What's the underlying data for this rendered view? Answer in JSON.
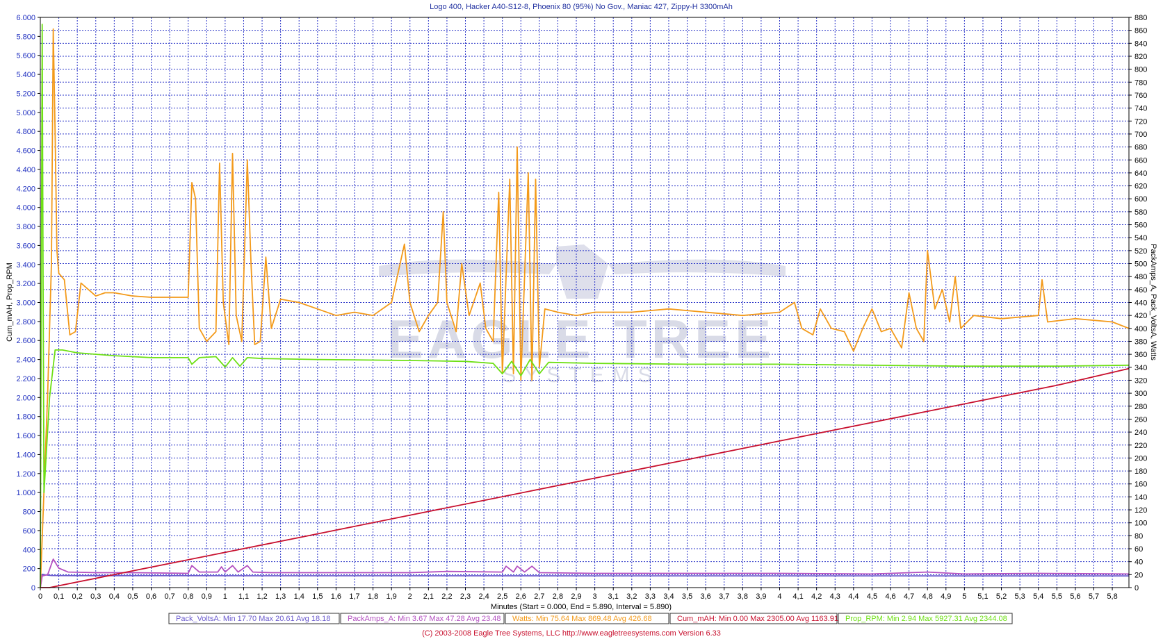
{
  "chart_data": {
    "type": "line",
    "title": "Logo 400, Hacker A40-S12-8, Phoenix 80 (95%) No Gov., Maniac 427, Zippy-H 3300mAh",
    "xlabel": "Minutes (Start = 0.000,  End = 5.890,  Interval =  5.890)",
    "ylabel_left": "Cum_mAH, Prop_RPM",
    "ylabel_right": "PackAmps_A, Pack_VoltsA, Watts",
    "xlim": [
      0,
      5.89
    ],
    "ylim_left": [
      0,
      6000
    ],
    "ylim_right": [
      0,
      880
    ],
    "grid": true,
    "x_ticks": [
      "0",
      "0,1",
      "0,2",
      "0,3",
      "0,4",
      "0,5",
      "0,6",
      "0,7",
      "0,8",
      "0,9",
      "1",
      "1,1",
      "1,2",
      "1,3",
      "1,4",
      "1,5",
      "1,6",
      "1,7",
      "1,8",
      "1,9",
      "2",
      "2,1",
      "2,2",
      "2,3",
      "2,4",
      "2,5",
      "2,6",
      "2,7",
      "2,8",
      "2,9",
      "3",
      "3,1",
      "3,2",
      "3,3",
      "3,4",
      "3,5",
      "3,6",
      "3,7",
      "3,8",
      "3,9",
      "4",
      "4,1",
      "4,2",
      "4,3",
      "4,4",
      "4,5",
      "4,6",
      "4,7",
      "4,8",
      "4,9",
      "5",
      "5,1",
      "5,2",
      "5,3",
      "5,4",
      "5,5",
      "5,6",
      "5,7",
      "5,8"
    ],
    "y_ticks_left": [
      "0",
      "200",
      "400",
      "600",
      "800",
      "1.000",
      "1.200",
      "1.400",
      "1.600",
      "1.800",
      "2.000",
      "2.200",
      "2.400",
      "2.600",
      "2.800",
      "3.000",
      "3.200",
      "3.400",
      "3.600",
      "3.800",
      "4.000",
      "4.200",
      "4.400",
      "4.600",
      "4.800",
      "5.000",
      "5.200",
      "5.400",
      "5.600",
      "5.800",
      "6.000"
    ],
    "y_ticks_right": [
      "0",
      "20",
      "40",
      "60",
      "80",
      "100",
      "120",
      "140",
      "160",
      "180",
      "200",
      "220",
      "240",
      "260",
      "280",
      "300",
      "320",
      "340",
      "360",
      "380",
      "400",
      "420",
      "440",
      "460",
      "480",
      "500",
      "520",
      "540",
      "560",
      "580",
      "600",
      "620",
      "640",
      "660",
      "680",
      "700",
      "720",
      "740",
      "760",
      "780",
      "800",
      "820",
      "840",
      "860",
      "880"
    ],
    "watermark": {
      "line1": "EAGLE TREE",
      "line2": "SYSTEMS"
    },
    "series": [
      {
        "name": "Pack_VoltsA",
        "axis": "right",
        "color": "#6a5acd",
        "points": [
          [
            0,
            0
          ],
          [
            0.01,
            20.6
          ],
          [
            0.03,
            19.6
          ],
          [
            0.06,
            18.6
          ],
          [
            0.2,
            18.4
          ],
          [
            0.5,
            18.4
          ],
          [
            0.8,
            18.3
          ],
          [
            1.2,
            18.2
          ],
          [
            2,
            18.2
          ],
          [
            3,
            18.1
          ],
          [
            4,
            18.1
          ],
          [
            5,
            18.0
          ],
          [
            5.89,
            18.0
          ]
        ]
      },
      {
        "name": "PackAmps_A",
        "axis": "right",
        "color": "#b34fc0",
        "points": [
          [
            0,
            0
          ],
          [
            0.01,
            18
          ],
          [
            0.04,
            20
          ],
          [
            0.07,
            44
          ],
          [
            0.1,
            30
          ],
          [
            0.15,
            24
          ],
          [
            0.3,
            23
          ],
          [
            0.5,
            23
          ],
          [
            0.8,
            22
          ],
          [
            0.82,
            34
          ],
          [
            0.86,
            24
          ],
          [
            0.96,
            24
          ],
          [
            0.98,
            32
          ],
          [
            1.0,
            24
          ],
          [
            1.04,
            34
          ],
          [
            1.07,
            24
          ],
          [
            1.12,
            34
          ],
          [
            1.15,
            24
          ],
          [
            1.25,
            23
          ],
          [
            1.5,
            23
          ],
          [
            2,
            23
          ],
          [
            2.2,
            25
          ],
          [
            2.5,
            24
          ],
          [
            2.52,
            33
          ],
          [
            2.56,
            24
          ],
          [
            2.58,
            33
          ],
          [
            2.62,
            24
          ],
          [
            2.66,
            33
          ],
          [
            2.7,
            23
          ],
          [
            3,
            22
          ],
          [
            3.5,
            22
          ],
          [
            4,
            22
          ],
          [
            4.5,
            21
          ],
          [
            4.8,
            24
          ],
          [
            5,
            21
          ],
          [
            5.4,
            22
          ],
          [
            5.89,
            21
          ]
        ]
      },
      {
        "name": "Watts",
        "axis": "right",
        "color": "#f39a1a",
        "points": [
          [
            0,
            0
          ],
          [
            0.02,
            150
          ],
          [
            0.04,
            300
          ],
          [
            0.06,
            500
          ],
          [
            0.07,
            862
          ],
          [
            0.08,
            700
          ],
          [
            0.09,
            520
          ],
          [
            0.1,
            485
          ],
          [
            0.13,
            475
          ],
          [
            0.16,
            390
          ],
          [
            0.19,
            395
          ],
          [
            0.22,
            470
          ],
          [
            0.26,
            460
          ],
          [
            0.3,
            450
          ],
          [
            0.35,
            455
          ],
          [
            0.4,
            455
          ],
          [
            0.5,
            450
          ],
          [
            0.6,
            448
          ],
          [
            0.7,
            448
          ],
          [
            0.8,
            448
          ],
          [
            0.82,
            625
          ],
          [
            0.84,
            600
          ],
          [
            0.86,
            400
          ],
          [
            0.9,
            380
          ],
          [
            0.95,
            395
          ],
          [
            0.97,
            655
          ],
          [
            0.99,
            440
          ],
          [
            1.02,
            375
          ],
          [
            1.04,
            670
          ],
          [
            1.06,
            420
          ],
          [
            1.09,
            380
          ],
          [
            1.12,
            660
          ],
          [
            1.14,
            500
          ],
          [
            1.16,
            375
          ],
          [
            1.19,
            380
          ],
          [
            1.22,
            510
          ],
          [
            1.25,
            400
          ],
          [
            1.3,
            445
          ],
          [
            1.4,
            440
          ],
          [
            1.5,
            430
          ],
          [
            1.6,
            420
          ],
          [
            1.7,
            425
          ],
          [
            1.8,
            420
          ],
          [
            1.9,
            440
          ],
          [
            1.97,
            530
          ],
          [
            2.0,
            440
          ],
          [
            2.05,
            395
          ],
          [
            2.1,
            420
          ],
          [
            2.15,
            440
          ],
          [
            2.18,
            580
          ],
          [
            2.2,
            440
          ],
          [
            2.25,
            395
          ],
          [
            2.28,
            500
          ],
          [
            2.32,
            420
          ],
          [
            2.38,
            470
          ],
          [
            2.41,
            400
          ],
          [
            2.45,
            380
          ],
          [
            2.48,
            610
          ],
          [
            2.5,
            330
          ],
          [
            2.54,
            630
          ],
          [
            2.56,
            330
          ],
          [
            2.58,
            680
          ],
          [
            2.6,
            320
          ],
          [
            2.64,
            640
          ],
          [
            2.66,
            320
          ],
          [
            2.68,
            630
          ],
          [
            2.7,
            340
          ],
          [
            2.73,
            430
          ],
          [
            2.8,
            425
          ],
          [
            2.9,
            420
          ],
          [
            3.0,
            425
          ],
          [
            3.2,
            425
          ],
          [
            3.4,
            430
          ],
          [
            3.6,
            425
          ],
          [
            3.8,
            420
          ],
          [
            4.0,
            425
          ],
          [
            4.08,
            440
          ],
          [
            4.12,
            400
          ],
          [
            4.18,
            390
          ],
          [
            4.22,
            430
          ],
          [
            4.28,
            400
          ],
          [
            4.35,
            395
          ],
          [
            4.4,
            365
          ],
          [
            4.45,
            400
          ],
          [
            4.5,
            430
          ],
          [
            4.55,
            395
          ],
          [
            4.6,
            400
          ],
          [
            4.66,
            370
          ],
          [
            4.7,
            455
          ],
          [
            4.74,
            400
          ],
          [
            4.78,
            380
          ],
          [
            4.8,
            520
          ],
          [
            4.84,
            430
          ],
          [
            4.88,
            460
          ],
          [
            4.92,
            410
          ],
          [
            4.95,
            480
          ],
          [
            4.98,
            400
          ],
          [
            5.05,
            420
          ],
          [
            5.2,
            415
          ],
          [
            5.4,
            420
          ],
          [
            5.42,
            475
          ],
          [
            5.45,
            410
          ],
          [
            5.6,
            415
          ],
          [
            5.8,
            410
          ],
          [
            5.89,
            400
          ]
        ]
      },
      {
        "name": "Cum_mAH",
        "axis": "left",
        "color": "#c8102e",
        "points": [
          [
            0,
            0
          ],
          [
            0.05,
            0
          ],
          [
            0.5,
            176
          ],
          [
            1,
            371
          ],
          [
            1.5,
            566
          ],
          [
            2,
            762
          ],
          [
            2.5,
            957
          ],
          [
            3,
            1152
          ],
          [
            3.5,
            1347
          ],
          [
            4,
            1543
          ],
          [
            4.5,
            1738
          ],
          [
            5,
            1933
          ],
          [
            5.5,
            2128
          ],
          [
            5.89,
            2305
          ]
        ]
      },
      {
        "name": "Prop_RPM",
        "axis": "left",
        "color": "#6ee015",
        "points": [
          [
            0,
            0
          ],
          [
            0.01,
            5927
          ],
          [
            0.015,
            3200
          ],
          [
            0.02,
            1000
          ],
          [
            0.05,
            2000
          ],
          [
            0.08,
            2500
          ],
          [
            0.12,
            2500
          ],
          [
            0.2,
            2470
          ],
          [
            0.4,
            2440
          ],
          [
            0.6,
            2420
          ],
          [
            0.8,
            2420
          ],
          [
            0.82,
            2350
          ],
          [
            0.86,
            2420
          ],
          [
            0.95,
            2430
          ],
          [
            1.0,
            2320
          ],
          [
            1.04,
            2420
          ],
          [
            1.08,
            2330
          ],
          [
            1.12,
            2420
          ],
          [
            1.2,
            2410
          ],
          [
            1.5,
            2400
          ],
          [
            2.0,
            2390
          ],
          [
            2.3,
            2380
          ],
          [
            2.45,
            2360
          ],
          [
            2.5,
            2250
          ],
          [
            2.55,
            2380
          ],
          [
            2.6,
            2230
          ],
          [
            2.65,
            2400
          ],
          [
            2.7,
            2250
          ],
          [
            2.75,
            2370
          ],
          [
            3.0,
            2360
          ],
          [
            3.5,
            2350
          ],
          [
            4.0,
            2350
          ],
          [
            4.5,
            2340
          ],
          [
            5.0,
            2330
          ],
          [
            5.5,
            2330
          ],
          [
            5.89,
            2340
          ]
        ]
      }
    ],
    "legend": [
      {
        "name": "Pack_VoltsA",
        "stats": "Min 17.70    Max 20.61    Avg 18.18",
        "color": "#6a5acd"
      },
      {
        "name": "PackAmps_A",
        "stats": "Min 3.67    Max 47.28    Avg 23.48",
        "color": "#b34fc0"
      },
      {
        "name": "Watts",
        "stats": "Min 75.64    Max 869.48    Avg 426.68",
        "color": "#f39a1a"
      },
      {
        "name": "Cum_mAH",
        "stats": "Min 0.00    Max 2305.00    Avg 1163.91",
        "color": "#c8102e"
      },
      {
        "name": "Prop_RPM",
        "stats": "Min 2.94    Max 5927.31    Avg 2344.08",
        "color": "#6ee015"
      }
    ],
    "footer": "(C) 2003-2008 Eagle Tree Systems, LLC      http://www.eagletreesystems.com     Version 6.33"
  }
}
